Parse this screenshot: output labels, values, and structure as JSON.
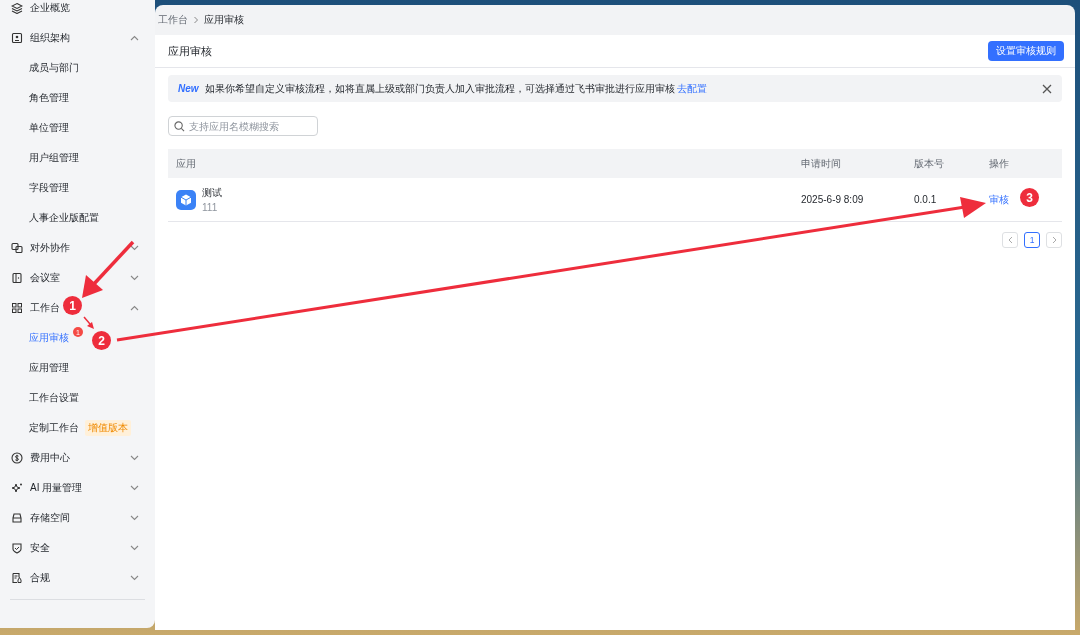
{
  "sidebar": {
    "items": [
      {
        "label": "企业概览"
      },
      {
        "label": "组织架构",
        "expanded": true,
        "children": [
          {
            "label": "成员与部门",
            "selected": false
          },
          {
            "label": "角色管理",
            "selected": false
          },
          {
            "label": "单位管理",
            "selected": false
          },
          {
            "label": "用户组管理",
            "selected": false
          },
          {
            "label": "字段管理",
            "selected": false
          },
          {
            "label": "人事企业版配置",
            "selected": false
          }
        ]
      },
      {
        "label": "对外协作",
        "expanded": false
      },
      {
        "label": "会议室",
        "expanded": false
      },
      {
        "label": "工作台",
        "expanded": true,
        "children": [
          {
            "label": "应用审核",
            "selected": true,
            "badge": "1"
          },
          {
            "label": "应用管理",
            "selected": false
          },
          {
            "label": "工作台设置",
            "selected": false
          },
          {
            "label": "定制工作台",
            "selected": false,
            "tag": "增值版本"
          }
        ]
      },
      {
        "label": "费用中心",
        "expanded": false
      },
      {
        "label": "AI 用量管理",
        "expanded": false
      },
      {
        "label": "存储空间",
        "expanded": false
      },
      {
        "label": "安全",
        "expanded": false
      },
      {
        "label": "合规",
        "expanded": false
      }
    ]
  },
  "breadcrumb": [
    {
      "label": "工作台"
    },
    {
      "label": "应用审核"
    }
  ],
  "page": {
    "title": "应用审核",
    "primary_button": "设置审核规则"
  },
  "notice": {
    "tag": "New",
    "text": "如果你希望自定义审核流程，如将直属上级或部门负责人加入审批流程，可选择通过飞书审批进行应用审核",
    "link": "去配置"
  },
  "search": {
    "placeholder": "支持应用名模糊搜索"
  },
  "table": {
    "columns": [
      "应用",
      "申请时间",
      "版本号",
      "操作"
    ],
    "rows": [
      {
        "name": "测试",
        "subtitle": "111",
        "time": "2025-6-9 8:09",
        "version": "0.0.1",
        "action": "审核"
      }
    ]
  },
  "pagination": {
    "pages": [
      {
        "label": "1",
        "selected": true
      }
    ]
  },
  "annotations": [
    {
      "label": "1"
    },
    {
      "label": "2"
    },
    {
      "label": "3"
    }
  ]
}
